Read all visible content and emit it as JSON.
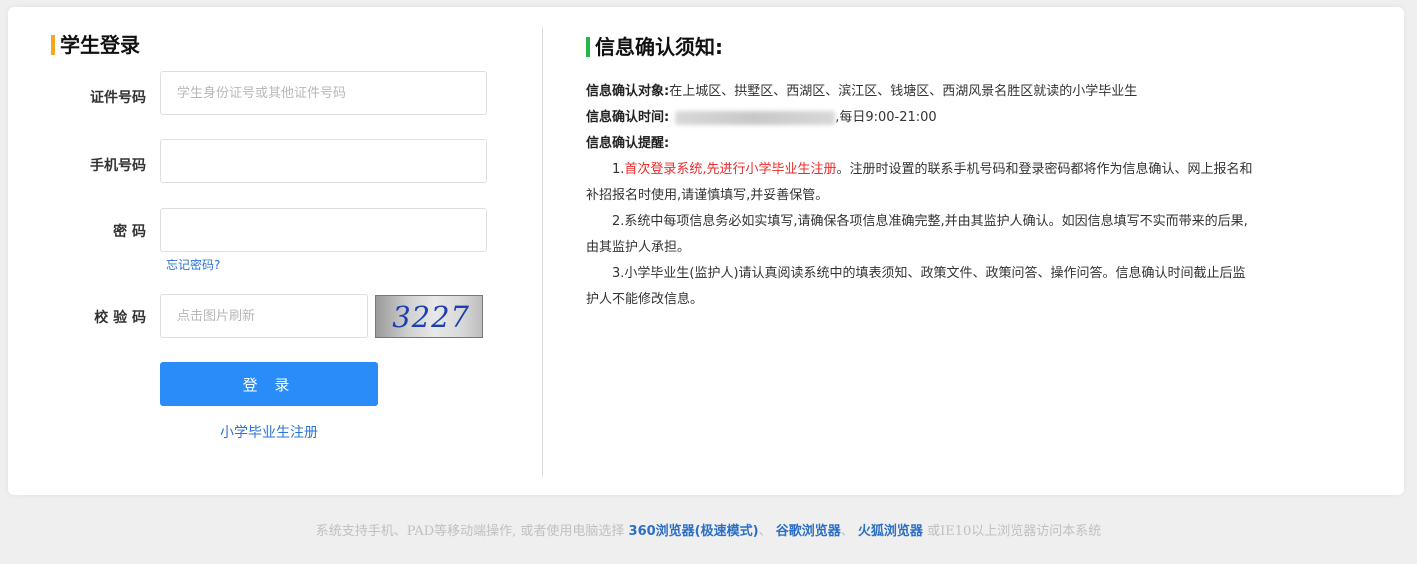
{
  "login": {
    "title": "学生登录",
    "id_label": "证件号码",
    "id_placeholder": "学生身份证号或其他证件号码",
    "phone_label": "手机号码",
    "phone_value": "",
    "password_label": "密 码",
    "password_value": "",
    "forgot_password": "忘记密码?",
    "captcha_label": "校 验 码",
    "captcha_placeholder": "点击图片刷新",
    "captcha_code": "3227",
    "login_button": "登 录",
    "register_link": "小学毕业生注册"
  },
  "notice": {
    "title": "信息确认须知:",
    "target_label": "信息确认对象:",
    "target_text": "在上城区、拱墅区、西湖区、滨江区、钱塘区、西湖风景名胜区就读的小学毕业生",
    "time_label": "信息确认时间:",
    "time_suffix": ",每日9:00-21:00",
    "reminder_label": "信息确认提醒:",
    "item1_prefix": "1.",
    "item1_red": "首次登录系统,先进行小学毕业生注册",
    "item1_rest": "。注册时设置的联系手机号码和登录密码都将作为信息确认、网上报名和补招报名时使用,请谨慎填写,并妥善保管。",
    "item2": "2.系统中每项信息务必如实填写,请确保各项信息准确完整,并由其监护人确认。如因信息填写不实而带来的后果,由其监护人承担。",
    "item3": "3.小学毕业生(监护人)请认真阅读系统中的填表须知、政策文件、政策问答、操作问答。信息确认时间截止后监护人不能修改信息。"
  },
  "footer": {
    "prefix": "系统支持手机、PAD等移动端操作, 或者使用电脑选择",
    "browser1": "360浏览器(极速模式)",
    "sep1": "、",
    "browser2": "谷歌浏览器",
    "sep2": "、",
    "browser3": "火狐浏览器",
    "suffix": "或IE10以上浏览器访问本系统"
  },
  "colors": {
    "login_accent": "#f5a623",
    "notice_accent": "#26b64a",
    "primary_button": "#2a8cf8",
    "link": "#2b73d9",
    "warning_red": "#ee2b2b"
  }
}
